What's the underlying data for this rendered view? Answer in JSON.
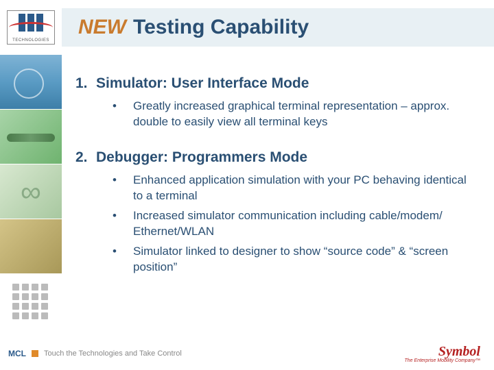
{
  "title": {
    "new": "NEW",
    "rest": "Testing Capability"
  },
  "sections": [
    {
      "num": "1.",
      "head": "Simulator: User Interface Mode",
      "bullets": [
        "Greatly increased graphical terminal representation – approx. double to easily view all terminal keys"
      ]
    },
    {
      "num": "2.",
      "head": "Debugger: Programmers Mode",
      "bullets": [
        "Enhanced application simulation with your PC behaving identical to a terminal",
        "Increased simulator communication including cable/modem/ Ethernet/WLAN",
        "Simulator linked to designer to show “source code” & “screen position”"
      ]
    }
  ],
  "footer": {
    "brand": "MCL",
    "tagline": "Touch the Technologies and Take Control",
    "partner": "Symbol",
    "partner_tag": "The Enterprise Mobility Company™"
  }
}
